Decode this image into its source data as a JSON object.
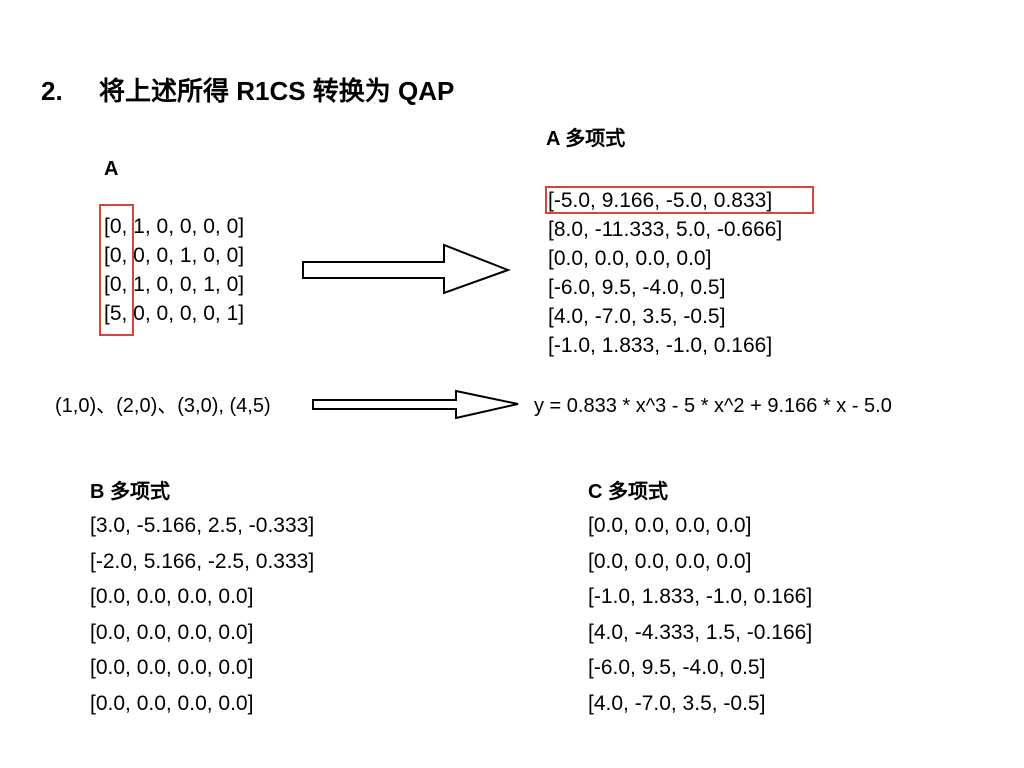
{
  "title": {
    "number": "2.",
    "text": "将上述所得 R1CS 转换为 QAP"
  },
  "matrix_a": {
    "label": "A",
    "rows": [
      "[0, 1, 0, 0, 0, 0]",
      "[0, 0, 0, 1, 0, 0]",
      "[0, 1, 0, 0, 1, 0]",
      "[5, 0, 0, 0, 0, 1]"
    ]
  },
  "a_polynomial": {
    "label": "A 多项式",
    "rows": [
      "[-5.0, 9.166, -5.0, 0.833]",
      "[8.0, -11.333, 5.0, -0.666]",
      "[0.0, 0.0, 0.0, 0.0]",
      "[-6.0, 9.5, -4.0, 0.5]",
      "[4.0, -7.0, 3.5, -0.5]",
      "[-1.0, 1.833, -1.0, 0.166]"
    ]
  },
  "points": "(1,0)、(2,0)、(3,0), (4,5)",
  "equation": "y = 0.833 * x^3 - 5 * x^2 + 9.166 * x - 5.0",
  "b_polynomial": {
    "label": "B 多项式",
    "rows": [
      "[3.0, -5.166, 2.5, -0.333]",
      "[-2.0, 5.166, -2.5, 0.333]",
      "[0.0, 0.0, 0.0, 0.0]",
      "[0.0, 0.0, 0.0, 0.0]",
      "[0.0, 0.0, 0.0, 0.0]",
      "[0.0, 0.0, 0.0, 0.0]"
    ]
  },
  "c_polynomial": {
    "label": "C 多项式",
    "rows": [
      "[0.0, 0.0, 0.0, 0.0]",
      "[0.0, 0.0, 0.0, 0.0]",
      "[-1.0, 1.833, -1.0, 0.166]",
      "[4.0, -4.333, 1.5, -0.166]",
      "[-6.0, 9.5, -4.0, 0.5]",
      "[4.0, -7.0, 3.5, -0.5]"
    ]
  },
  "colors": {
    "highlight": "#d9443a",
    "text": "#000000",
    "background": "#ffffff"
  }
}
